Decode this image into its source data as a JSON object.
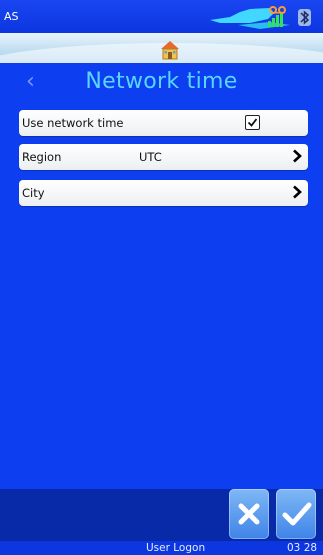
{
  "status": {
    "left_text": "AS"
  },
  "header": {
    "title": "Network time",
    "back_icon": "chevron-left-icon",
    "home_icon": "home-icon"
  },
  "settings": {
    "use_network_time": {
      "label": "Use network time",
      "checked": true
    },
    "region": {
      "label": "Region",
      "value": "UTC"
    },
    "city": {
      "label": "City",
      "value": ""
    }
  },
  "footer": {
    "user_logon": "User Logon",
    "time": "03 28"
  },
  "colors": {
    "background": "#0d3ff0",
    "title": "#58d6ff",
    "button": "#5a9af0",
    "panel": "#082aa8"
  }
}
